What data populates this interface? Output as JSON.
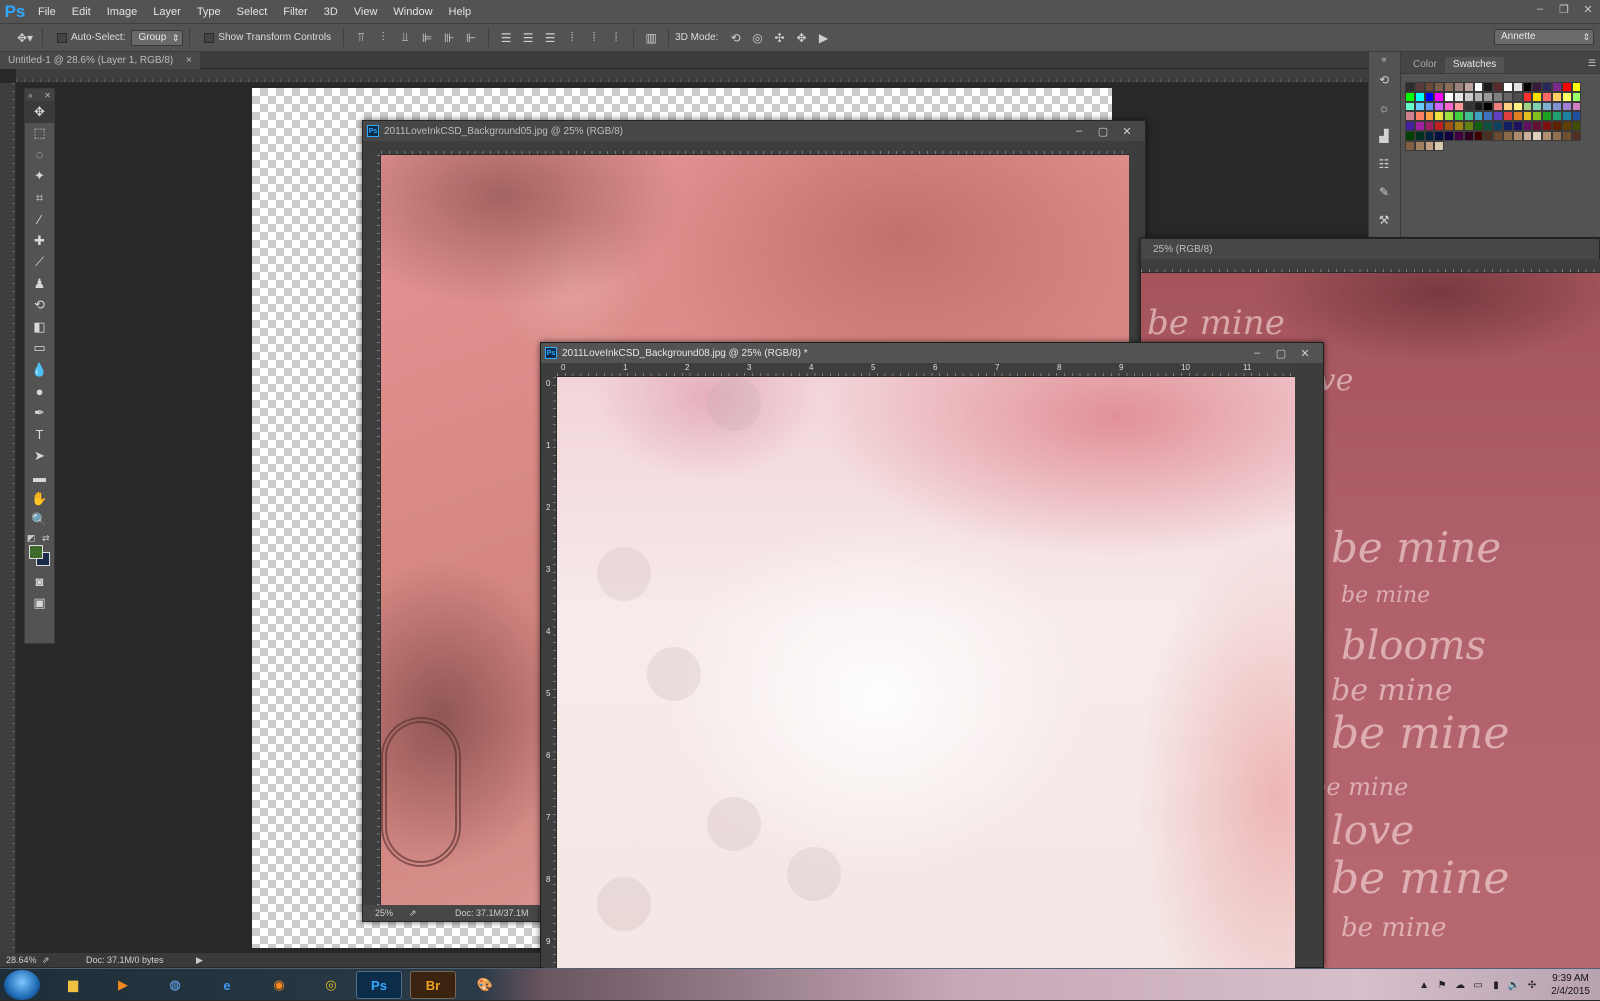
{
  "app": {
    "logo": "Ps",
    "menus": [
      "File",
      "Edit",
      "Image",
      "Layer",
      "Type",
      "Select",
      "Filter",
      "3D",
      "View",
      "Window",
      "Help"
    ]
  },
  "options": {
    "auto_select_label": "Auto-Select:",
    "auto_select_value": "Group",
    "transform_label": "Show Transform Controls",
    "mode_3d_label": "3D Mode:",
    "workspace": "Annette"
  },
  "main_doc": {
    "tab_title": "Untitled-1 @ 28.6% (Layer 1, RGB/8)",
    "close": "×",
    "zoom": "28.64%",
    "doc_info": "Doc: 37.1M/0 bytes"
  },
  "win05": {
    "title": "2011LoveInkCSD_Background05.jpg @ 25% (RGB/8)",
    "zoom": "25%",
    "doc_info": "Doc: 37.1M/37.1M"
  },
  "win08": {
    "title": "2011LoveInkCSD_Background08.jpg @ 25% (RGB/8) *",
    "ruler_x": [
      "0",
      "1",
      "2",
      "3",
      "4",
      "5",
      "6",
      "7",
      "8",
      "9",
      "10",
      "11"
    ],
    "ruler_y": [
      "0",
      "1",
      "2",
      "3",
      "4",
      "5",
      "6",
      "7",
      "8",
      "9"
    ]
  },
  "win_right": {
    "title": "25% (RGB/8)",
    "script_text": [
      "be mine",
      "love",
      "blooms"
    ]
  },
  "panels": {
    "color_tab": "Color",
    "swatches_tab": "Swatches",
    "swatch_colors": [
      "#2d2d2d",
      "#5a3a3a",
      "#6b4a3c",
      "#7a5c4a",
      "#8a6c5c",
      "#9c8278",
      "#b9a49c",
      "#ffffff",
      "#1a1a1a",
      "#5a2a2a",
      "#ffffff",
      "#e0e0e0",
      "#000000",
      "#3a1a3a",
      "#2a2a5a",
      "#7a2a8a",
      "#ff0000",
      "#ffff00",
      "#00ff00",
      "#00ffff",
      "#0000ff",
      "#ff00ff",
      "#ffffff",
      "#e6e6e6",
      "#cccccc",
      "#b3b3b3",
      "#999999",
      "#808080",
      "#666666",
      "#4d4d4d",
      "#ff3030",
      "#ffe000",
      "#ff6666",
      "#ffcc66",
      "#ffff66",
      "#99ff66",
      "#66ffcc",
      "#66ccff",
      "#6699ff",
      "#cc66ff",
      "#ff66cc",
      "#ff9999",
      "#333333",
      "#1a1a1a",
      "#000000",
      "#f08080",
      "#ffd080",
      "#fff080",
      "#a0d080",
      "#80d0b0",
      "#80b0d0",
      "#8090d0",
      "#a080d0",
      "#d080c0",
      "#d08090",
      "#ff8060",
      "#ffa040",
      "#f0e040",
      "#a0e040",
      "#40d040",
      "#40c090",
      "#40a0c0",
      "#4070c0",
      "#6040c0",
      "#e04040",
      "#e08020",
      "#e0c020",
      "#80c020",
      "#20a020",
      "#20a070",
      "#2080a0",
      "#2050a0",
      "#4020a0",
      "#a020a0",
      "#a02060",
      "#c02020",
      "#a05010",
      "#a08010",
      "#608010",
      "#106010",
      "#105040",
      "#104060",
      "#102060",
      "#201060",
      "#601060",
      "#601030",
      "#801010",
      "#602000",
      "#604000",
      "#405000",
      "#004000",
      "#003020",
      "#002040",
      "#001040",
      "#100040",
      "#400040",
      "#300020",
      "#400000",
      "#4a3020",
      "#6a4a30",
      "#8a6a4a",
      "#aa8a6a",
      "#cab09a",
      "#e0d0c0",
      "#b09070",
      "#907050",
      "#705030",
      "#503020",
      "#806040",
      "#a08060",
      "#c0a080",
      "#d8c8b0"
    ]
  },
  "taskbar": {
    "clock_time": "9:39 AM",
    "clock_date": "2/4/2015",
    "ps_label": "Ps",
    "br_label": "Br"
  },
  "colors": {
    "foreground": "#3e6b2c",
    "background": "#1a2a4a"
  }
}
